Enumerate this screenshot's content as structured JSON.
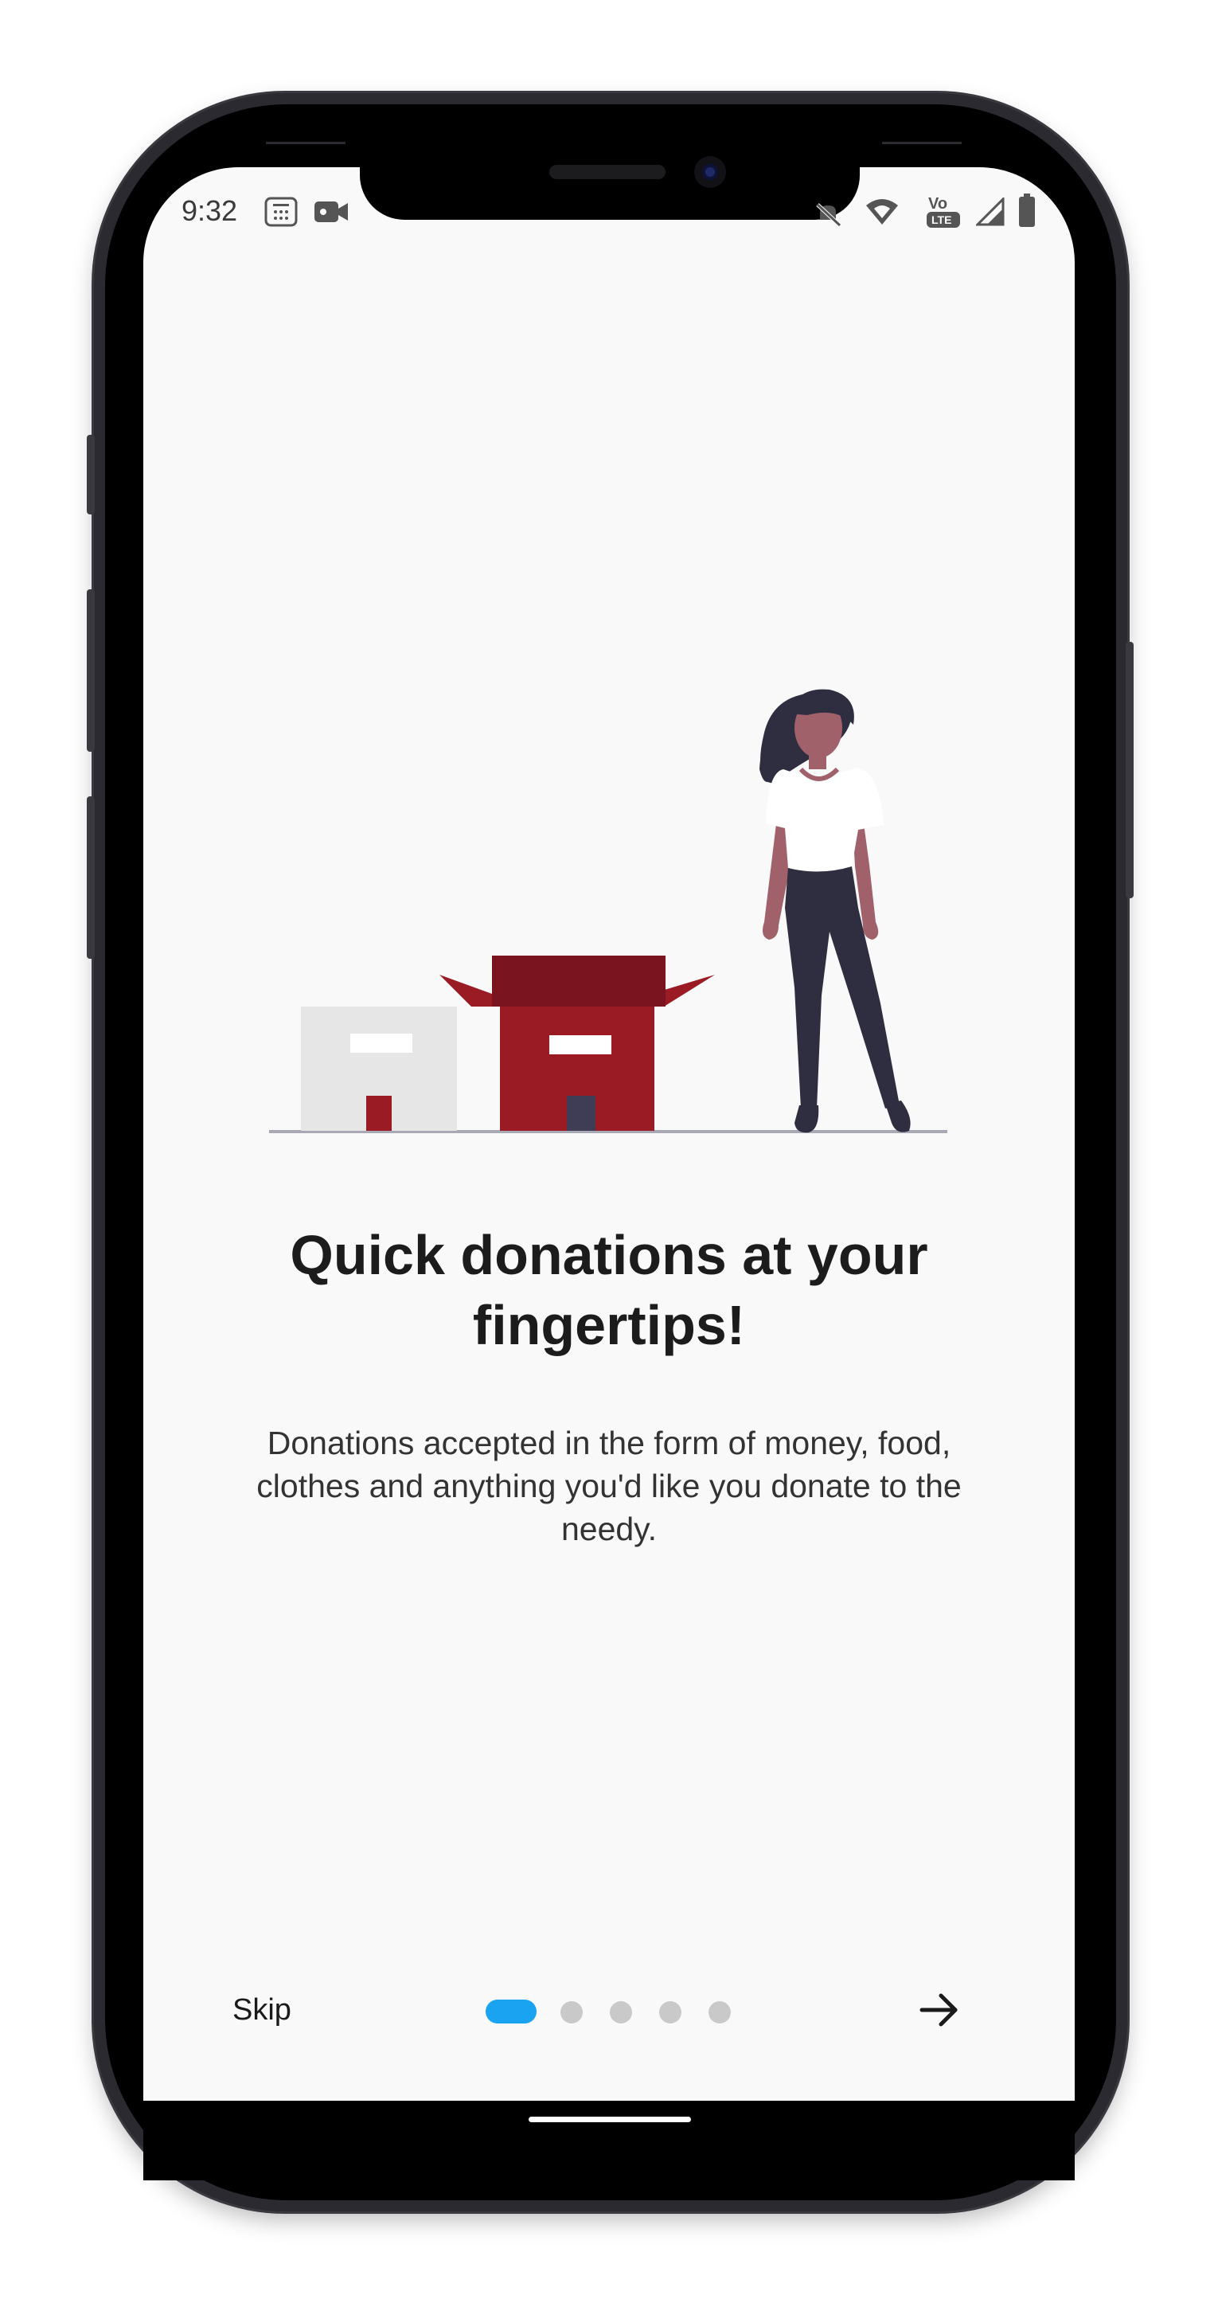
{
  "status_bar": {
    "time": "9:32",
    "left_icons": [
      "keypad-icon",
      "video-camera-icon"
    ],
    "right_icons": [
      "mute-icon",
      "wifi-icon",
      "volte-icon",
      "signal-icon",
      "battery-icon"
    ],
    "volte_label_top": "Vo",
    "volte_label_bottom": "LTE"
  },
  "onboarding": {
    "illustration": "person-with-donation-boxes",
    "title": "Quick donations at your fingertips!",
    "description": "Donations accepted in the form of money, food, clothes and anything you'd like you donate to the needy."
  },
  "controls": {
    "skip_label": "Skip",
    "page_count": 5,
    "active_page": 1,
    "next_icon": "arrow-right-icon"
  },
  "colors": {
    "background": "#f9f9f9",
    "accent": "#1aa3f0",
    "inactive_dot": "#c9c9c9",
    "box_red": "#9b1b24",
    "box_red_dark": "#7a1520",
    "box_grey": "#e6e6e6",
    "person_skin": "#a0616a",
    "person_pants": "#2f2e41",
    "person_shirt": "#ffffff",
    "text": "#1c1c1c"
  }
}
